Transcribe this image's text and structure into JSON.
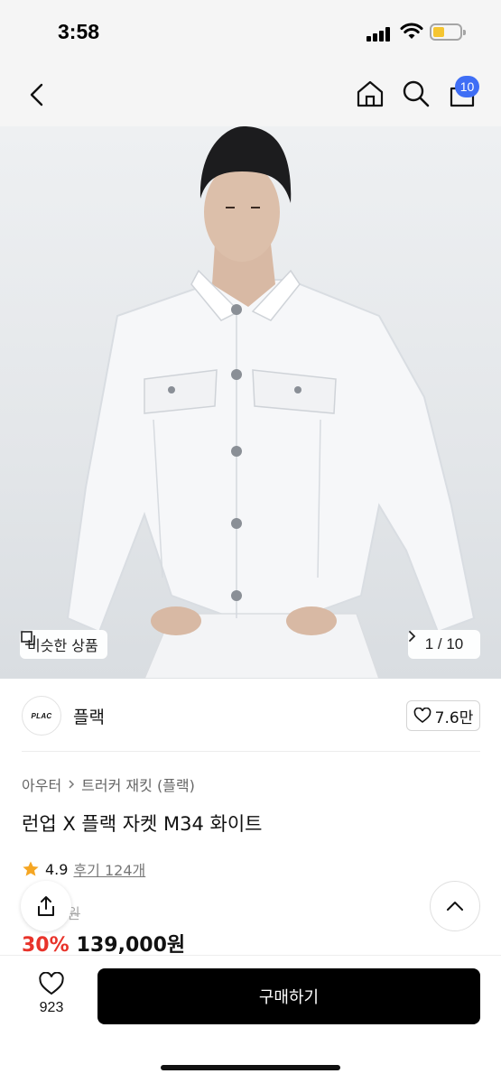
{
  "status_bar": {
    "time": "3:58"
  },
  "nav": {
    "cart_count": "10"
  },
  "gallery": {
    "similar_label": "비슷한 상품",
    "page_indicator": "1 / 10"
  },
  "brand": {
    "logo_text": "PLAC",
    "name": "플랙",
    "likes": "7.6만"
  },
  "product": {
    "breadcrumb": [
      "아우터",
      "트러커 재킷 (플랙)"
    ],
    "title": "런업 X 플랙 자켓 M34 화이트",
    "rating": "4.9",
    "reviews": "후기 124개",
    "original_price_visible": "0원",
    "discount": "30%",
    "price": "139,000원"
  },
  "bottom_bar": {
    "wish_count": "923",
    "buy_label": "구매하기"
  }
}
